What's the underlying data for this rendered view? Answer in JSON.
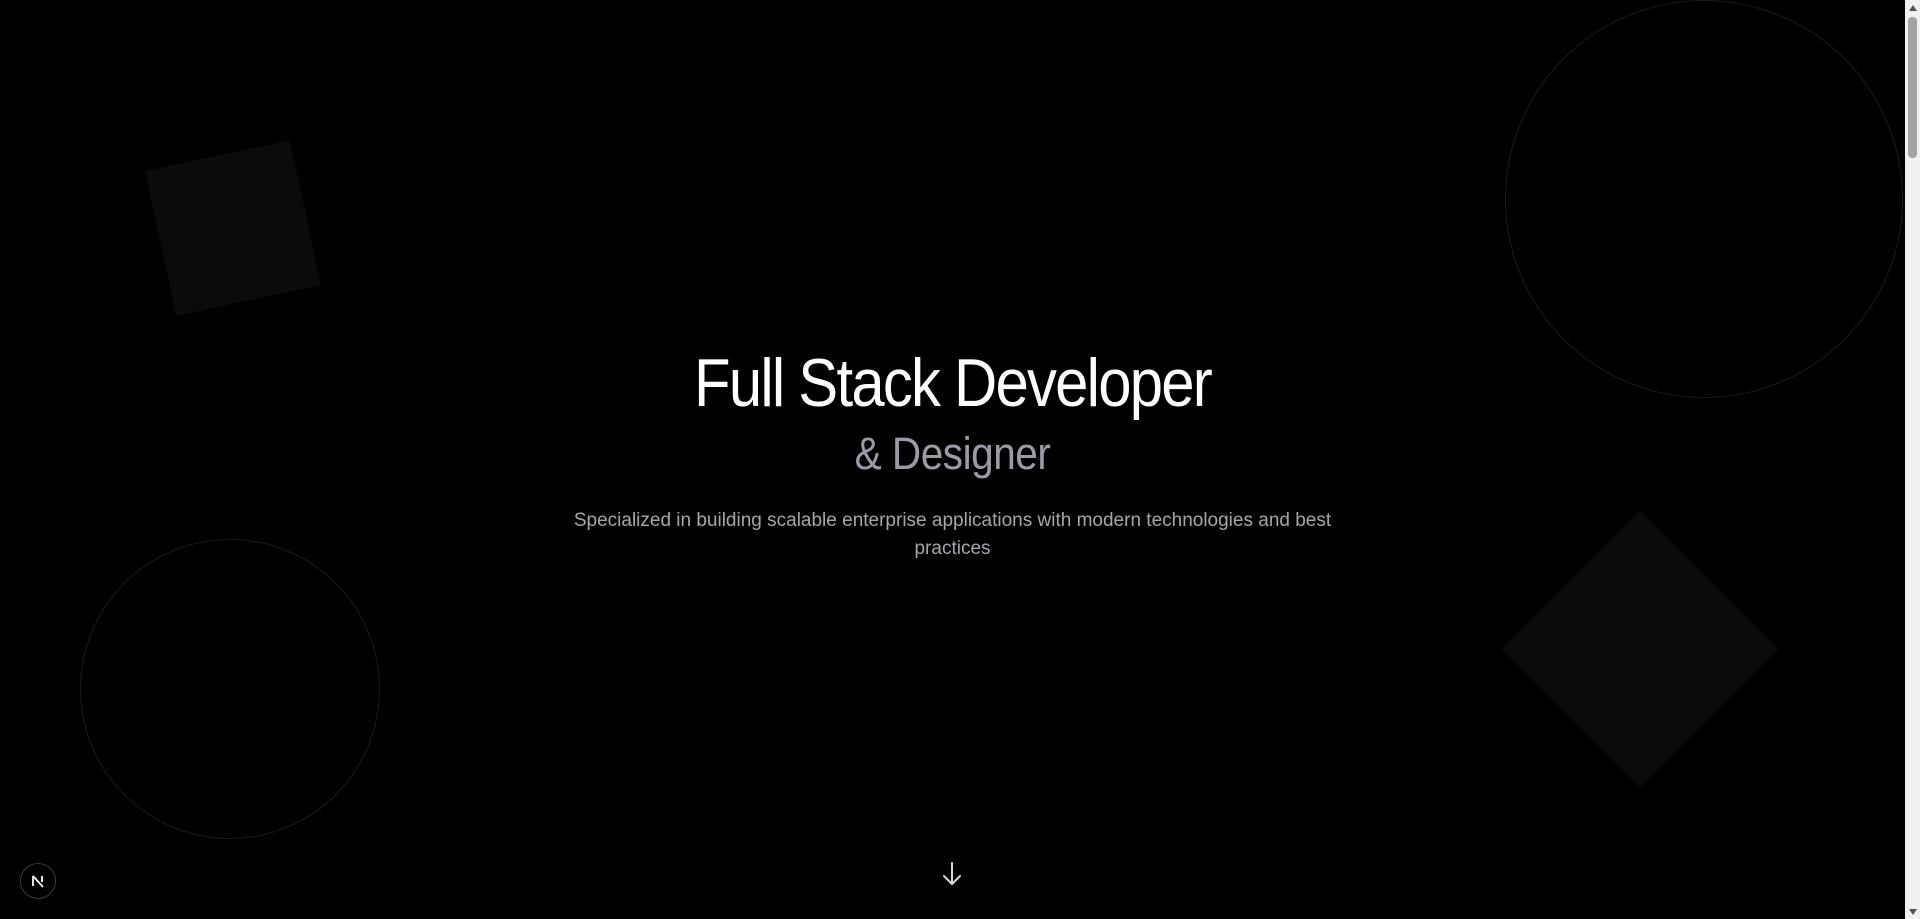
{
  "hero": {
    "title": "Full Stack Developer",
    "subtitle": "& Designer",
    "description": "Specialized in building scalable enterprise applications with modern technologies and best practices"
  },
  "icons": {
    "scroll_down": "arrow-down-icon",
    "framework_badge": "nextjs-logo-icon"
  },
  "colors": {
    "background": "#000000",
    "title": "#ffffff",
    "subtitle": "#9b9ba6",
    "description": "#a6a6ad",
    "shape_fill": "#0b0b0b",
    "shape_outline": "#1a1a1a"
  }
}
